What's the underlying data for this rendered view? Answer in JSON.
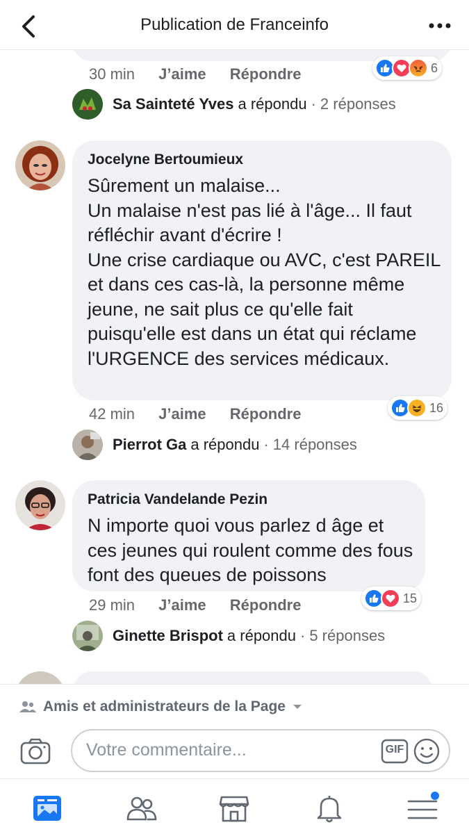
{
  "header": {
    "title": "Publication de Franceinfo",
    "back_icon": "chevron-left-icon",
    "more_icon": "more-dots-icon"
  },
  "colors": {
    "like_blue": "#1877f2",
    "love_red": "#f33e58",
    "angry_orange": "#e9710f",
    "haha_yellow": "#f7b125",
    "text_dark": "#1c1e21",
    "text_grey": "#65676b",
    "bubble_bg": "#f0f2f5"
  },
  "prev_comment": {
    "time": "30 min",
    "like_label": "J’aime",
    "reply_label": "Répondre",
    "reactions": [
      "like",
      "love",
      "angry"
    ],
    "reaction_count": "6",
    "reply": {
      "name": "Sa Sainteté Yves",
      "action": "a répondu",
      "separator": "·",
      "count": "2 réponses"
    }
  },
  "comments": [
    {
      "author": "Jocelyne Bertoumieux",
      "text": "Sûrement un malaise...\nUn malaise n'est pas lié à l'âge... Il faut réfléchir avant d'écrire !\nUne crise cardiaque ou AVC, c'est PAREIL et dans ces cas-là, la personne même jeune, ne sait plus ce qu'elle fait puisqu'elle est dans un état qui réclame l'URGENCE des services médicaux.",
      "time": "42 min",
      "like_label": "J’aime",
      "reply_label": "Répondre",
      "reactions": [
        "like",
        "haha"
      ],
      "reaction_count": "16",
      "reply": {
        "name": "Pierrot Ga",
        "action": "a répondu",
        "separator": "·",
        "count": "14 réponses"
      }
    },
    {
      "author": "Patricia Vandelande Pezin",
      "text": "N importe quoi vous parlez d âge et ces jeunes qui roulent comme des fous font des queues de poissons",
      "time": "29 min",
      "like_label": "J’aime",
      "reply_label": "Répondre",
      "reactions": [
        "like",
        "love"
      ],
      "reaction_count": "15",
      "reply": {
        "name": "Ginette Brispot",
        "action": "a répondu",
        "separator": "·",
        "count": "5 réponses"
      }
    }
  ],
  "composer": {
    "audience": "Amis et administrateurs de la Page",
    "placeholder": "Votre commentaire...",
    "gif_label": "GIF",
    "camera_icon": "camera-icon",
    "emoji_icon": "emoji-icon"
  },
  "tabbar": {
    "items": [
      "news-feed-icon",
      "friends-icon",
      "marketplace-icon",
      "notifications-bell-icon",
      "menu-icon"
    ],
    "active": "news-feed-icon"
  }
}
